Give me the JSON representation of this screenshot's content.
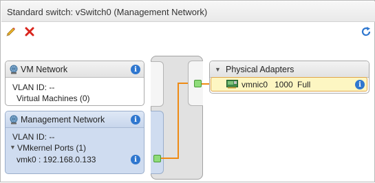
{
  "window": {
    "title": "Standard switch: vSwitch0 (Management Network)"
  },
  "toolbar": {
    "edit_icon": "pencil-icon",
    "remove_icon": "red-x-icon",
    "refresh_icon": "refresh-icon"
  },
  "vm_network": {
    "title": "VM Network",
    "vlan_label": "VLAN ID: --",
    "vms_label": "Virtual Machines (0)"
  },
  "management_network": {
    "title": "Management Network",
    "vlan_label": "VLAN ID: --",
    "ports_label": "VMkernel Ports (1)",
    "port_entry": "vmk0 : 192.168.0.133"
  },
  "physical_adapters": {
    "title": "Physical Adapters",
    "adapter": {
      "name": "vmnic0",
      "speed": "1000",
      "duplex": "Full"
    }
  },
  "colors": {
    "connection": "#ef8a12",
    "info": "#2f77cf",
    "remove": "#d9241c",
    "refresh": "#2f77cf"
  }
}
